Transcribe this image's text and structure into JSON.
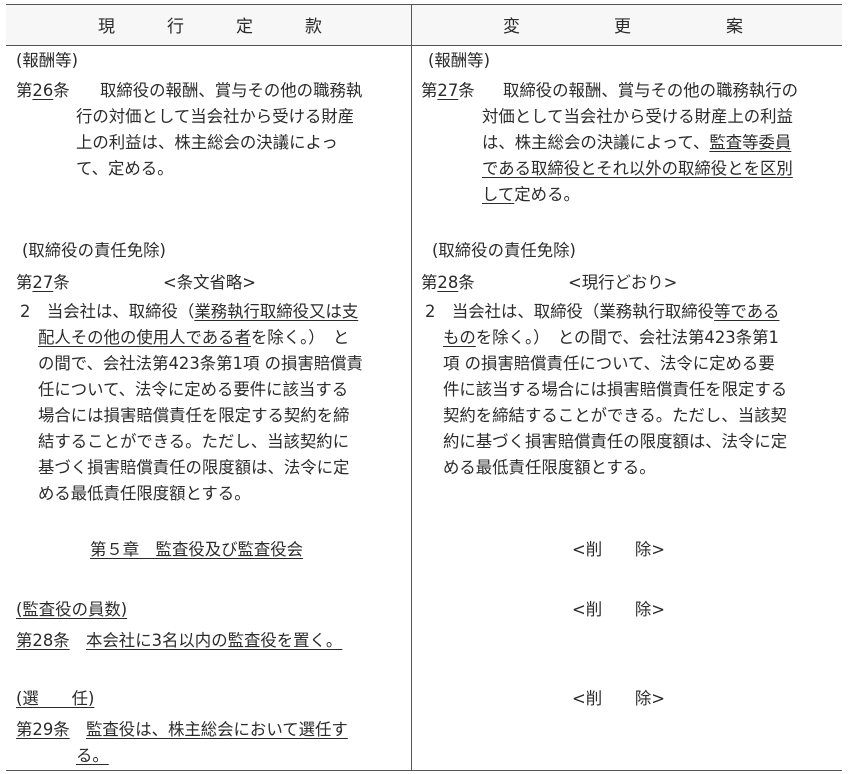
{
  "header": {
    "left_chars": [
      "現",
      "行",
      "定",
      "款"
    ],
    "right_chars": [
      "変",
      "更",
      "案"
    ]
  },
  "left": {
    "remuneration_heading": "(報酬等)",
    "art26_prefix": "第",
    "art26_num": "26",
    "art26_suffix": "条",
    "art26_line1": "取締役の報酬、賞与その他の職務執",
    "art26_line2": "行の対価として当会社から受ける財産",
    "art26_line3": "上の利益は、株主総会の決議によっ",
    "art26_line4": "て、定める。",
    "exemption_heading": "(取締役の責任免除)",
    "art27_prefix": "第",
    "art27_num": "27",
    "art27_suffix": "条",
    "art27_omitted": "<条文省略>",
    "para2_line1_a": "2　当会社は、取締役（",
    "para2_line1_u1": "業務執行取締役",
    "para2_line1_u2": "又は支",
    "para2_line2_u": "配人その他の使用人",
    "para2_line2_b": "である者",
    "para2_line2_c": "を除く。）　と",
    "para2_line3": "の間で、会社法第423条第1項 の損害賠償責",
    "para2_line4": "任について、法令に定める要件に該当する",
    "para2_line5": "場合には損害賠償責任を限定する契約を締",
    "para2_line6": "結することができる。ただし、当該契約に",
    "para2_line7": "基づく損害賠償責任の限度額は、法令に定",
    "para2_line8": "める最低責任限度額とする。",
    "chapter5": "第５章　監査役及び監査役会",
    "auditor_count_heading": "(監査役の員数)",
    "art28_label": "第28条",
    "art28_text": "本会社に3名以内の監査役を置く。",
    "election_heading": "(選　　任)",
    "art29_label": "第29条",
    "art29_line1": "監査役は、株主総会において選任す",
    "art29_line2": "る。"
  },
  "right": {
    "remuneration_heading": "(報酬等)",
    "art27_prefix": "第",
    "art27_num": "27",
    "art27_suffix": "条",
    "art27_line1": "取締役の報酬、賞与その他の職務執行の",
    "art27_line2": "対価として当会社から受ける財産上の利益",
    "art27_line3_a": "は、株主総会の決議によって、",
    "art27_line3_u": "監査等委員",
    "art27_line4_u": "である取締役とそれ以外の取締役とを区別",
    "art27_line5_u": "して",
    "art27_line5_b": "定める。",
    "exemption_heading": "(取締役の責任免除)",
    "art28_prefix": "第",
    "art28_num": "28",
    "art28_suffix": "条",
    "art28_same": "<現行どおり>",
    "para2_line1_a": "2　当会社は、取締役（業務執行取締役",
    "para2_line1_u": "等である",
    "para2_line2_u": "もの",
    "para2_line2_b": "を除く。）　との間で、会社法第423条第1",
    "para2_line3": "項 の損害賠償責任について、法令に定める要",
    "para2_line4": "件に該当する場合には損害賠償責任を限定する",
    "para2_line5": "契約を締結することができる。ただし、当該契",
    "para2_line6": "約に基づく損害賠償責任の限度額は、法令に定",
    "para2_line7": "める最低責任限度額とする。",
    "deleted_1": "<削　　除>",
    "deleted_2": "<削　　除>",
    "deleted_3": "<削　　除>"
  }
}
